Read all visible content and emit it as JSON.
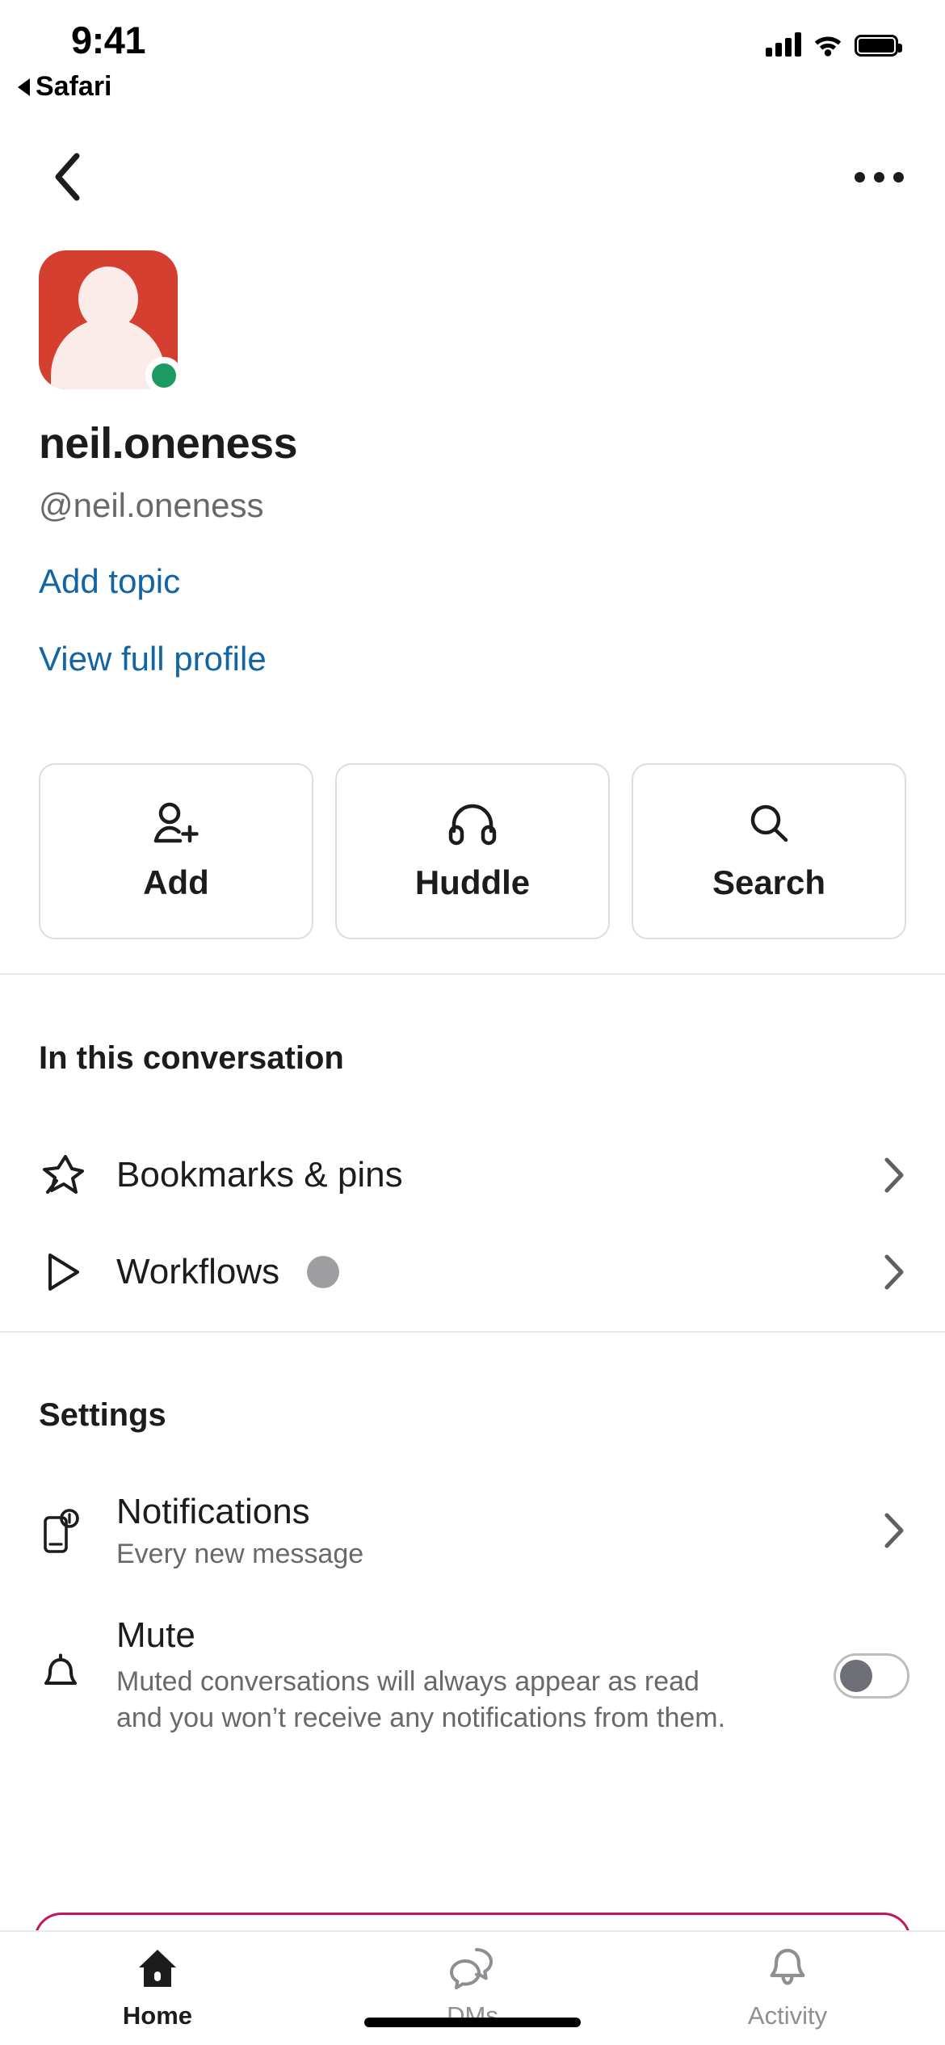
{
  "status_bar": {
    "time": "9:41",
    "back_app": "Safari",
    "signal_icon": "cellular-bars-icon",
    "wifi_icon": "wifi-icon",
    "battery_icon": "battery-icon"
  },
  "nav": {
    "back_icon": "chevron-left-icon",
    "more_icon": "more-options-icon"
  },
  "profile": {
    "avatar_icon": "avatar-placeholder-icon",
    "avatar_color": "#D53F2F",
    "presence_color": "#1C9A62",
    "presence_state": "active",
    "display_name": "neil.oneness",
    "handle": "@neil.oneness",
    "add_topic_label": "Add topic",
    "view_profile_label": "View full profile",
    "link_color": "#1264A3"
  },
  "actions": [
    {
      "label": "Add",
      "icon": "person-add-icon"
    },
    {
      "label": "Huddle",
      "icon": "headphones-icon"
    },
    {
      "label": "Search",
      "icon": "search-icon"
    }
  ],
  "conversation_section": {
    "title": "In this conversation",
    "rows": [
      {
        "title": "Bookmarks & pins",
        "icon": "pin-icon",
        "accessory": "chevron-right-icon"
      },
      {
        "title": "Workflows",
        "icon": "workflow-play-icon",
        "accessory": "chevron-right-icon",
        "badge": "loading-dot"
      }
    ]
  },
  "settings_section": {
    "title": "Settings",
    "notifications": {
      "title": "Notifications",
      "subtitle": "Every new message",
      "icon": "mobile-notification-icon",
      "accessory": "chevron-right-icon"
    },
    "mute": {
      "title": "Mute",
      "description": "Muted conversations will always appear as read and you won’t receive any notifications from them.",
      "icon": "bell-icon",
      "toggle_state": "off"
    }
  },
  "tabbar": {
    "tabs": [
      {
        "label": "Home",
        "icon": "home-icon",
        "active": true
      },
      {
        "label": "DMs",
        "icon": "dms-bubbles-icon",
        "active": false
      },
      {
        "label": "Activity",
        "icon": "bell-icon",
        "active": false
      }
    ]
  }
}
